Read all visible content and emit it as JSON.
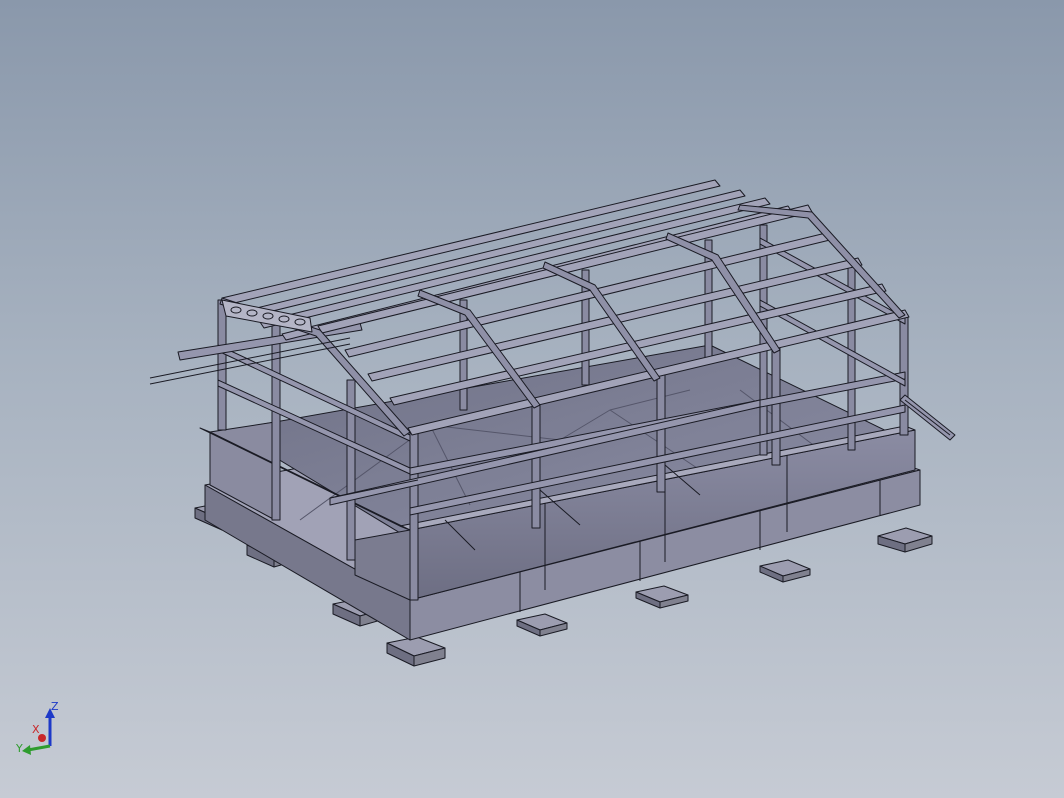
{
  "viewport": {
    "background_top": "#8a98ab",
    "background_bottom": "#c6cbd4",
    "model_fill": "#7c7d92",
    "model_edge": "#1a1b24"
  },
  "triad": {
    "z_label": "Z",
    "x_label": "X",
    "y_label": "Y",
    "z_color": "#1d39c8",
    "x_color": "#c8282a",
    "y_color": "#2e9c2e"
  }
}
